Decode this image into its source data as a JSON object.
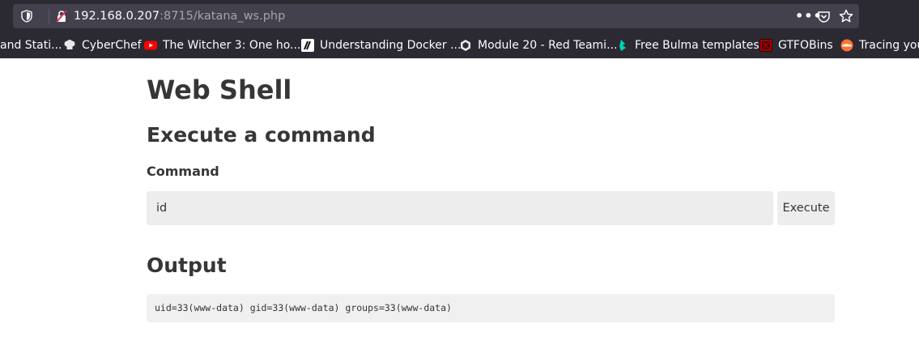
{
  "browser": {
    "url_host": "192.168.0.207",
    "url_path": ":8715/katana_ws.php",
    "more_glyph": "•••",
    "colors": {
      "chrome_bg": "#2b2a33",
      "urlbar_bg": "#42414d",
      "text": "#fbfbfe",
      "dim_text": "#a4a3ac"
    },
    "bookmarks": [
      {
        "label": "and Stati...",
        "icon": "none",
        "color": ""
      },
      {
        "label": "CyberChef",
        "icon": "chef-hat-icon",
        "color": "#e8e8e8"
      },
      {
        "label": "The Witcher 3: One ho...",
        "icon": "youtube-icon",
        "color": "#ff0000"
      },
      {
        "label": "Understanding Docker ...",
        "icon": "blog-logo-icon",
        "color": "#ffffff"
      },
      {
        "label": "Module 20 - Red Teami...",
        "icon": "hackthebox-icon",
        "color": "#9fef00"
      },
      {
        "label": "Free Bulma templates",
        "icon": "bulma-icon",
        "color": "#00d1b2"
      },
      {
        "label": "GTFOBins",
        "icon": "gtfobins-icon",
        "color": "#cc0000"
      },
      {
        "label": "Tracing you",
        "icon": "firefox-icon",
        "color": "#ff7139"
      }
    ]
  },
  "page": {
    "title": "Web Shell",
    "section_title": "Execute a command",
    "command_label": "Command",
    "command_value": "id",
    "execute_label": "Execute",
    "output_title": "Output",
    "output_text": "uid=33(www-data) gid=33(www-data) groups=33(www-data)"
  }
}
